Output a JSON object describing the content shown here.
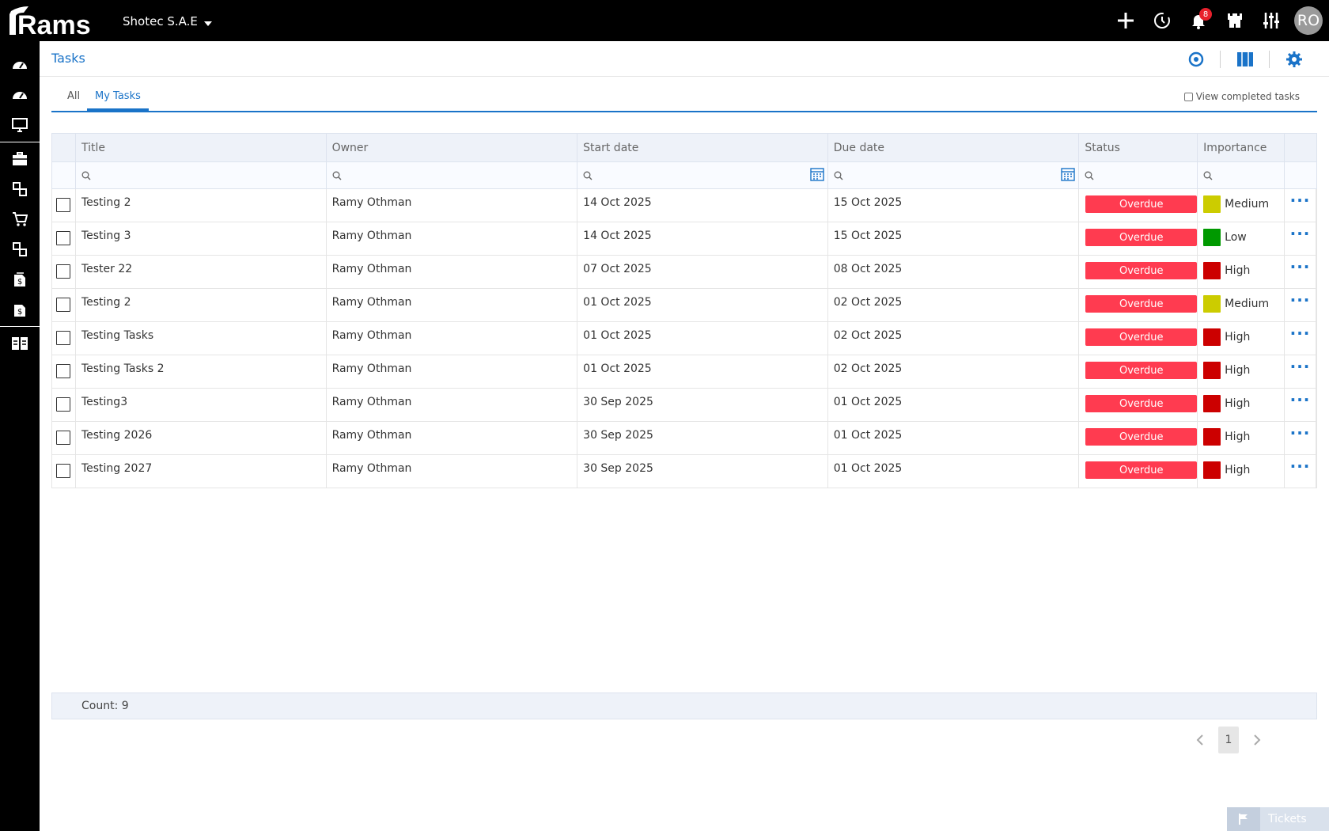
{
  "app": {
    "logo_text": "Rams",
    "company": "Shotec S.A.E",
    "notification_count": "8",
    "user_initials": "RO"
  },
  "page": {
    "title": "Tasks"
  },
  "tabs": [
    {
      "label": "All",
      "active": false
    },
    {
      "label": "My Tasks",
      "active": true
    }
  ],
  "view_completed_label": "View completed tasks",
  "grid": {
    "columns": [
      "Title",
      "Owner",
      "Start date",
      "Due date",
      "Status",
      "Importance"
    ],
    "rows": [
      {
        "title": "Testing 2",
        "owner": "Ramy Othman",
        "start": "14 Oct 2025",
        "due": "15 Oct 2025",
        "status": "Overdue",
        "importance": "Medium",
        "imp_color": "#cccc00"
      },
      {
        "title": "Testing 3",
        "owner": "Ramy Othman",
        "start": "14 Oct 2025",
        "due": "15 Oct 2025",
        "status": "Overdue",
        "importance": "Low",
        "imp_color": "#009900"
      },
      {
        "title": "Tester 22",
        "owner": "Ramy Othman",
        "start": "07 Oct 2025",
        "due": "08 Oct 2025",
        "status": "Overdue",
        "importance": "High",
        "imp_color": "#cc0000"
      },
      {
        "title": "Testing 2",
        "owner": "Ramy Othman",
        "start": "01 Oct 2025",
        "due": "02 Oct 2025",
        "status": "Overdue",
        "importance": "Medium",
        "imp_color": "#cccc00"
      },
      {
        "title": "Testing Tasks",
        "owner": "Ramy Othman",
        "start": "01 Oct 2025",
        "due": "02 Oct 2025",
        "status": "Overdue",
        "importance": "High",
        "imp_color": "#cc0000"
      },
      {
        "title": "Testing Tasks 2",
        "owner": "Ramy Othman",
        "start": "01 Oct 2025",
        "due": "02 Oct 2025",
        "status": "Overdue",
        "importance": "High",
        "imp_color": "#cc0000"
      },
      {
        "title": "Testing3",
        "owner": "Ramy Othman",
        "start": "30 Sep 2025",
        "due": "01 Oct 2025",
        "status": "Overdue",
        "importance": "High",
        "imp_color": "#cc0000"
      },
      {
        "title": "Testing 2026",
        "owner": "Ramy Othman",
        "start": "30 Sep 2025",
        "due": "01 Oct 2025",
        "status": "Overdue",
        "importance": "High",
        "imp_color": "#cc0000"
      },
      {
        "title": "Testing 2027",
        "owner": "Ramy Othman",
        "start": "30 Sep 2025",
        "due": "01 Oct 2025",
        "status": "Overdue",
        "importance": "High",
        "imp_color": "#cc0000"
      }
    ],
    "count_label": "Count: 9"
  },
  "pager": {
    "current": "1"
  },
  "tickets_label": "Tickets",
  "colors": {
    "accent": "#1a73c8",
    "overdue": "#ff3b50"
  }
}
